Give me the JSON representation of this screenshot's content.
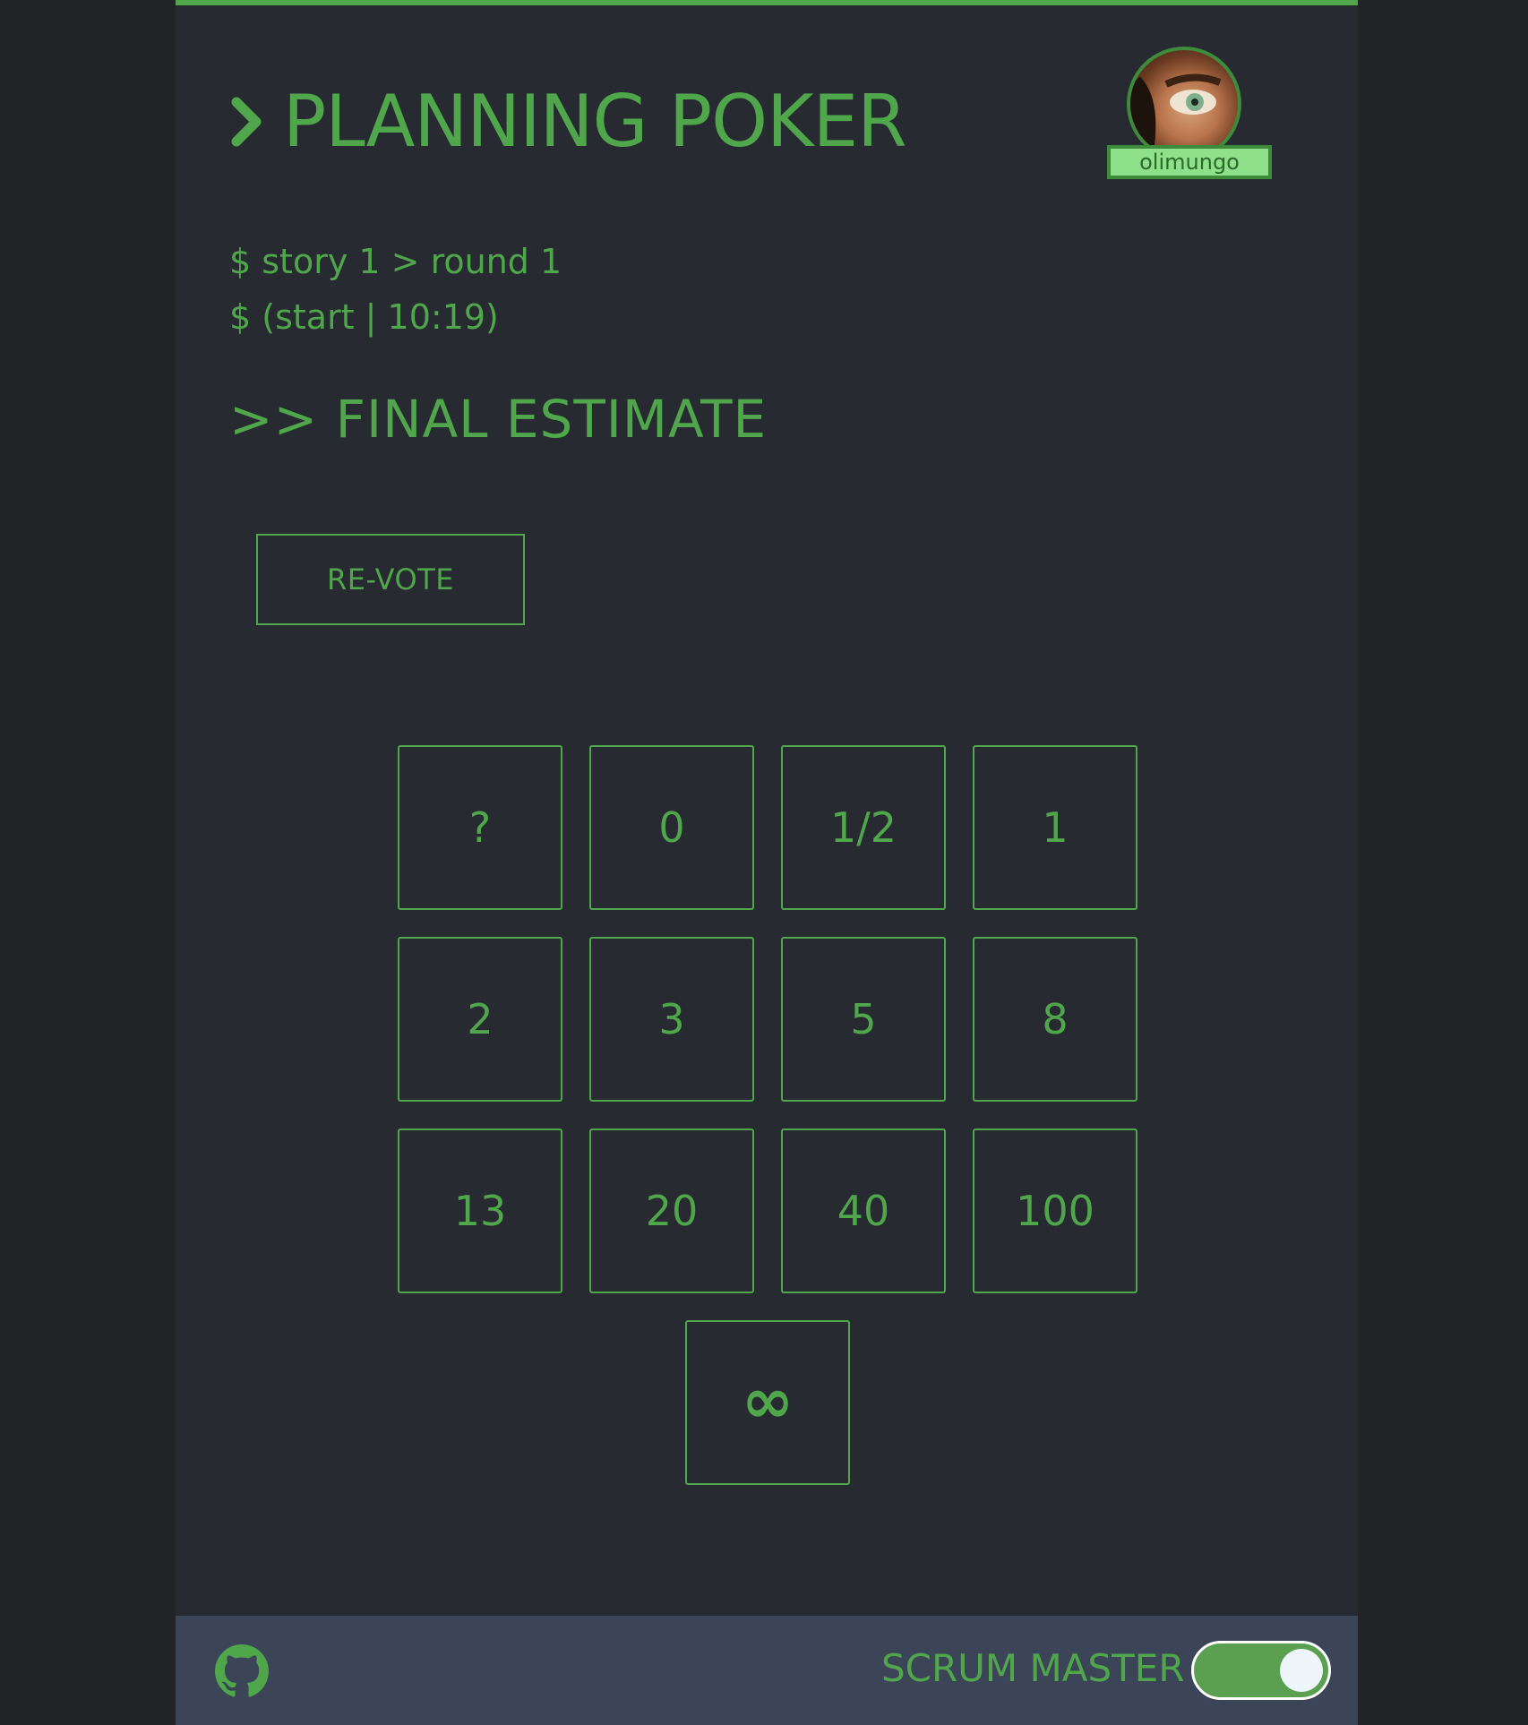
{
  "header": {
    "title": "PLANNING POKER",
    "user": {
      "name": "olimungo"
    }
  },
  "info": {
    "line1": "$ story 1 > round 1",
    "line2": "$ (start | 10:19)"
  },
  "heading": ">> FINAL ESTIMATE",
  "revote_label": "RE-VOTE",
  "cards": [
    "?",
    "0",
    "1/2",
    "1",
    "2",
    "3",
    "5",
    "8",
    "13",
    "20",
    "40",
    "100",
    "∞"
  ],
  "footer": {
    "github_icon": "github-icon",
    "scrum_master_label": "SCRUM MASTER",
    "scrum_master_enabled": true
  },
  "colors": {
    "accent": "#4fa64b",
    "background": "#272a30",
    "footer": "#3c4457",
    "user_badge": "#8fe08a"
  }
}
